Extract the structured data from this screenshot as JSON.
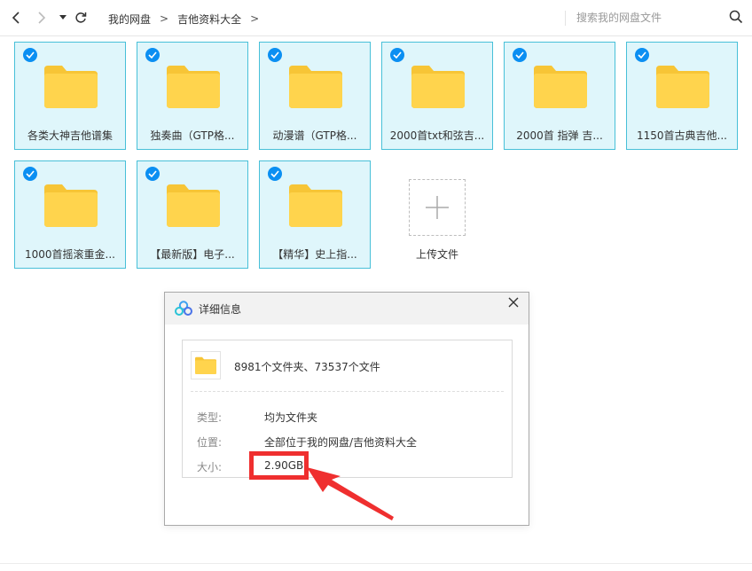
{
  "breadcrumb": {
    "items": [
      "我的网盘",
      "吉他资料大全"
    ],
    "separator": ">"
  },
  "search": {
    "placeholder": "搜索我的网盘文件",
    "value": ""
  },
  "folders": [
    {
      "name": "各类大神吉他谱集",
      "selected": true
    },
    {
      "name": "独奏曲（GTP格...",
      "selected": true
    },
    {
      "name": "动漫谱（GTP格...",
      "selected": true
    },
    {
      "name": "2000首txt和弦吉...",
      "selected": true
    },
    {
      "name": "2000首 指弹 吉...",
      "selected": true
    },
    {
      "name": "1150首古典吉他...",
      "selected": true
    },
    {
      "name": "1000首摇滚重金...",
      "selected": true
    },
    {
      "name": "【最新版】电子...",
      "selected": true
    },
    {
      "name": "【精华】史上指...",
      "selected": true
    }
  ],
  "upload": {
    "label": "上传文件"
  },
  "details_dialog": {
    "title": "详细信息",
    "summary": "8981个文件夹、73537个文件",
    "type_label": "类型:",
    "type_value": "均为文件夹",
    "location_label": "位置:",
    "location_value": "全部位于我的网盘/吉他资料大全",
    "size_label": "大小:",
    "size_value": "2.90GB"
  },
  "colors": {
    "tile_bg": "#dff6fb",
    "tile_border": "#48c0d8",
    "check_blue": "#0b8ff2",
    "folder_yellow": "#ffd44d",
    "highlight_red": "#ef2f2f"
  }
}
